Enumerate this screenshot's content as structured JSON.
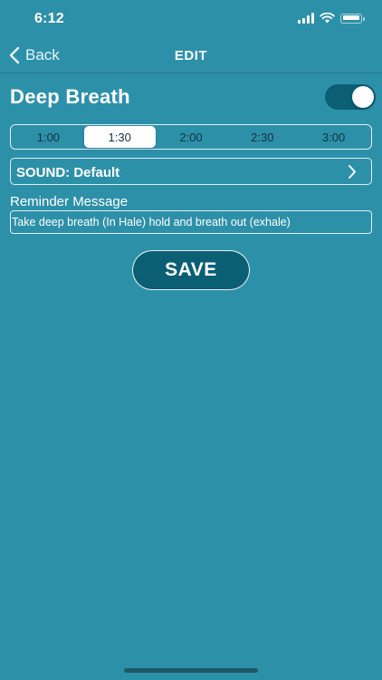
{
  "status_bar": {
    "time": "6:12"
  },
  "nav": {
    "back_label": "Back",
    "title": "EDIT"
  },
  "item": {
    "title": "Deep Breath",
    "enabled": true
  },
  "durations": {
    "options": [
      "1:00",
      "1:30",
      "2:00",
      "2:30",
      "3:00"
    ],
    "selected": "1:30"
  },
  "sound": {
    "label": "SOUND: Default"
  },
  "reminder": {
    "label": "Reminder Message",
    "value": "Take deep breath (In Hale) hold and breath out (exhale)"
  },
  "save_label": "SAVE",
  "colors": {
    "background": "#2d90a9",
    "accent_dark": "#0b5f74",
    "text": "#ffffff"
  }
}
